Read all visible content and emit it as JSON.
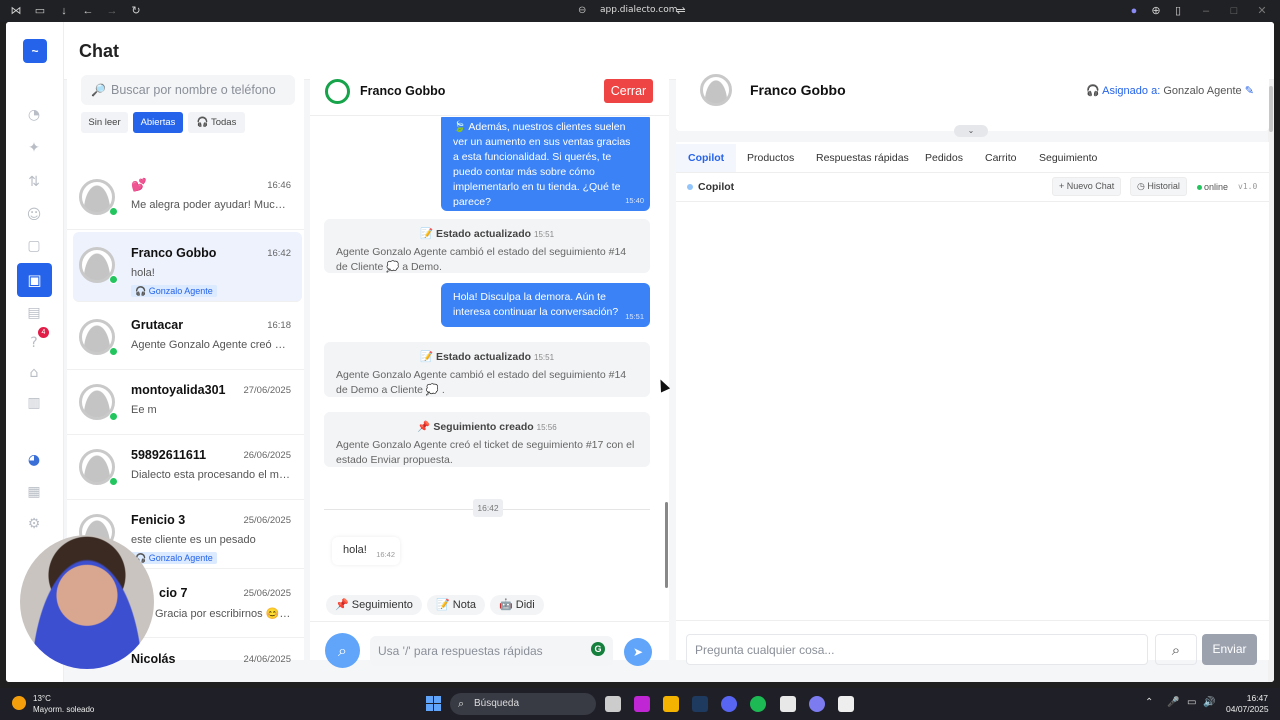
{
  "browser": {
    "url": "app.dialecto.com"
  },
  "app": {
    "title": "Chat"
  },
  "sidebar": {
    "badge": "4"
  },
  "list": {
    "search_placeholder": "Buscar por nombre o teléfono",
    "filters": [
      "Sin leer",
      "Abiertas",
      "Todas"
    ],
    "conversations": [
      {
        "name": "💕",
        "time": "16:46",
        "preview": "Me alegra poder ayudar! Mucha ...",
        "tag": ""
      },
      {
        "name": "Franco Gobbo",
        "time": "16:42",
        "preview": "hola!",
        "tag": "Gonzalo Agente"
      },
      {
        "name": "Grutacar",
        "time": "16:18",
        "preview": "Agente Gonzalo Agente creó el ti...",
        "tag": ""
      },
      {
        "name": "montoyalida301",
        "time": "27/06/2025",
        "preview": "Ee m",
        "tag": ""
      },
      {
        "name": "59892611611",
        "time": "26/06/2025",
        "preview": "Dialecto esta procesando el men...",
        "tag": ""
      },
      {
        "name": "Fenicio 3",
        "time": "25/06/2025",
        "preview": "este cliente es un pesado",
        "tag": "Gonzalo Agente"
      },
      {
        "name": "cio 7",
        "time": "25/06/2025",
        "preview": "Gracia por escribirnos 😊 U...",
        "tag": ""
      },
      {
        "name": "Nicolás",
        "time": "24/06/2025",
        "preview": "",
        "tag": ""
      }
    ]
  },
  "chat": {
    "contact": "Franco Gobbo",
    "close_label": "Cerrar",
    "msg1": {
      "text": "🍃 Además, nuestros clientes suelen ver un aumento en sus ventas gracias a esta funcionalidad. Si querés, te puedo contar más sobre cómo implementarlo en tu tienda. ¿Qué te parece?",
      "time": "15:40"
    },
    "sys1": {
      "title": "📝 Estado actualizado",
      "time": "15:51",
      "text": "Agente Gonzalo Agente cambió el estado del seguimiento #14 de Cliente 💭 a Demo."
    },
    "msg2": {
      "text": "Hola! Disculpa la demora. Aún te interesa continuar la conversación?",
      "time": "15:51"
    },
    "sys2": {
      "title": "📝 Estado actualizado",
      "time": "15:51",
      "text": "Agente Gonzalo Agente cambió el estado del seguimiento #14 de Demo a Cliente 💭 ."
    },
    "sys3": {
      "title": "📌 Seguimiento creado",
      "time": "15:56",
      "text": "Agente Gonzalo Agente creó el ticket de seguimiento #17 con el estado Enviar propuesta."
    },
    "day_time": "16:42",
    "incoming": {
      "text": "hola!",
      "time": "16:42"
    },
    "quick": [
      "📌 Seguimiento",
      "📝 Nota",
      "🤖 Didi"
    ],
    "input_placeholder": "Usa '/' para respuestas rápidas"
  },
  "right": {
    "name": "Franco Gobbo",
    "assigned_label": "Asignado a:",
    "assigned_name": "Gonzalo Agente",
    "tabs": [
      "Copilot",
      "Productos",
      "Respuestas rápidas",
      "Pedidos",
      "Carrito",
      "Seguimiento"
    ],
    "copilot_title": "Copilot",
    "new_chat": "+ Nuevo Chat",
    "history": "Historial",
    "status": "online",
    "version": "v1.0",
    "input_placeholder": "Pregunta cualquier cosa...",
    "send_label": "Enviar"
  },
  "taskbar": {
    "temp": "13°C",
    "weather": "Mayorm. soleado",
    "search": "Búsqueda",
    "time": "16:47",
    "date": "04/07/2025"
  }
}
